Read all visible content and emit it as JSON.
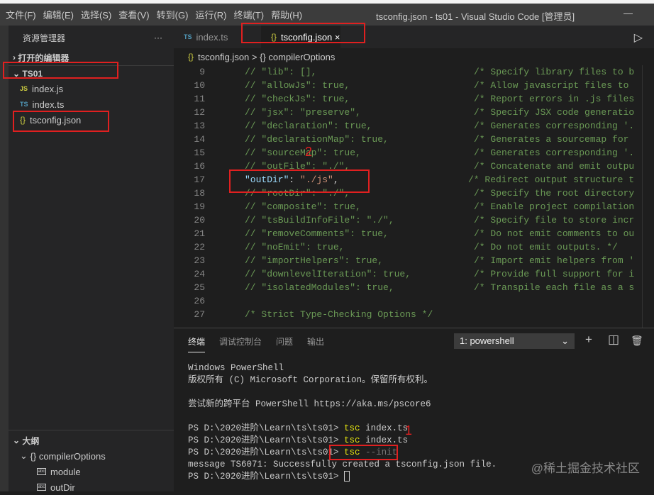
{
  "menu": [
    "文件(F)",
    "编辑(E)",
    "选择(S)",
    "查看(V)",
    "转到(G)",
    "运行(R)",
    "终端(T)",
    "帮助(H)"
  ],
  "window_title": "tsconfig.json - ts01 - Visual Studio Code [管理员]",
  "sidebar": {
    "title": "资源管理器",
    "more": "···",
    "open_editors": "打开的编辑器",
    "folder": "TS01",
    "files": [
      {
        "icon": "JS",
        "name": "index.js"
      },
      {
        "icon": "TS",
        "name": "index.ts"
      },
      {
        "icon": "{}",
        "name": "tsconfig.json"
      }
    ],
    "outline": {
      "title": "大纲",
      "root": "compilerOptions",
      "items": [
        "module",
        "outDir"
      ]
    }
  },
  "tabs": [
    {
      "icon": "TS",
      "label": "index.ts"
    },
    {
      "icon": "{}",
      "label": "tsconfig.json",
      "close": "×"
    }
  ],
  "breadcrumb": {
    "file": "tsconfig.json",
    "sep": ">",
    "node": "compilerOptions"
  },
  "code_lines": [
    {
      "n": "9",
      "code": "// \"lib\": [],",
      "comment": "/* Specify library files to b"
    },
    {
      "n": "10",
      "code": "// \"allowJs\": true,",
      "comment": "/* Allow javascript files to "
    },
    {
      "n": "11",
      "code": "// \"checkJs\": true,",
      "comment": "/* Report errors in .js files"
    },
    {
      "n": "12",
      "code": "// \"jsx\": \"preserve\",",
      "comment": "/* Specify JSX code generatio"
    },
    {
      "n": "13",
      "code": "// \"declaration\": true,",
      "comment": "/* Generates corresponding '."
    },
    {
      "n": "14",
      "code": "// \"declarationMap\": true,",
      "comment": "/* Generates a sourcemap for "
    },
    {
      "n": "15",
      "code": "// \"sourceMap\": true,",
      "comment": "/* Generates corresponding '."
    },
    {
      "n": "16",
      "code": "// \"outFile\": \"./\",",
      "comment": "/* Concatenate and emit outpu"
    },
    {
      "n": "17",
      "key": "\"outDir\"",
      "colon": ": ",
      "val": "\"./js\"",
      "tail": ",",
      "comment": "/* Redirect output structure t"
    },
    {
      "n": "18",
      "code": "// \"rootDir\": \"./\",",
      "comment": "/* Specify the root directory"
    },
    {
      "n": "19",
      "code": "// \"composite\": true,",
      "comment": "/* Enable project compilation"
    },
    {
      "n": "20",
      "code": "// \"tsBuildInfoFile\": \"./\",",
      "comment": "/* Specify file to store incr"
    },
    {
      "n": "21",
      "code": "// \"removeComments\": true,",
      "comment": "/* Do not emit comments to ou"
    },
    {
      "n": "22",
      "code": "// \"noEmit\": true,",
      "comment": "/* Do not emit outputs. */"
    },
    {
      "n": "23",
      "code": "// \"importHelpers\": true,",
      "comment": "/* Import emit helpers from '"
    },
    {
      "n": "24",
      "code": "// \"downlevelIteration\": true,",
      "comment": "/* Provide full support for i"
    },
    {
      "n": "25",
      "code": "// \"isolatedModules\": true,",
      "comment": "/* Transpile each file as a s"
    },
    {
      "n": "26",
      "code": "",
      "comment": ""
    },
    {
      "n": "27",
      "code": "/* Strict Type-Checking Options */",
      "comment": ""
    }
  ],
  "panel": {
    "tabs": [
      "终端",
      "调试控制台",
      "问题",
      "输出"
    ],
    "shell": "1: powershell",
    "add": "+",
    "split": "◫",
    "trash": "🗑"
  },
  "terminal": {
    "l1": "Windows PowerShell",
    "l2": "版权所有 (C) Microsoft Corporation。保留所有权利。",
    "l3": "尝试新的跨平台 PowerShell https://aka.ms/pscore6",
    "prompt": "PS D:\\2020进阶\\Learn\\ts\\ts01> ",
    "cmd": "tsc",
    "arg1": " index.ts",
    "arg3": " --init",
    "msg": "message TS6071: Successfully created a tsconfig.json file."
  },
  "annotations": {
    "a1": "1",
    "a2": "2"
  },
  "watermark": "@稀土掘金技术社区"
}
